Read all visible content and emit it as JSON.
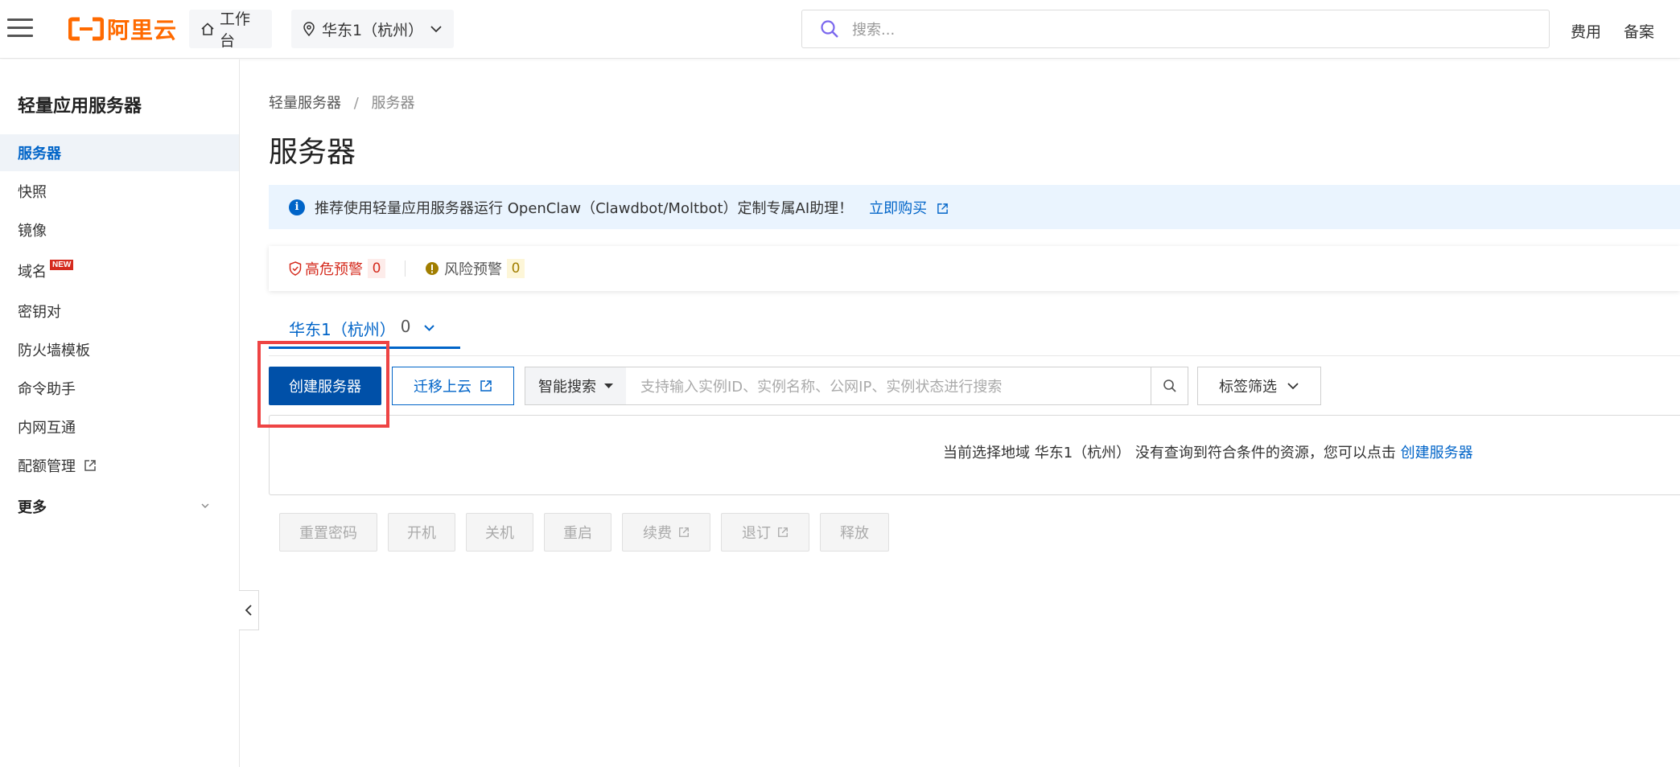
{
  "topbar": {
    "logo_text": "阿里云",
    "workbench_label": "工作台",
    "region_label": "华东1（杭州）",
    "search_placeholder": "搜索...",
    "links": [
      "费用",
      "备案"
    ]
  },
  "sidebar": {
    "title": "轻量应用服务器",
    "items": [
      {
        "label": "服务器",
        "active": true
      },
      {
        "label": "快照"
      },
      {
        "label": "镜像"
      },
      {
        "label": "域名",
        "badge": "NEW"
      },
      {
        "label": "密钥对"
      },
      {
        "label": "防火墙模板"
      },
      {
        "label": "命令助手"
      },
      {
        "label": "内网互通"
      },
      {
        "label": "配额管理",
        "external": true
      }
    ],
    "more_label": "更多"
  },
  "main": {
    "breadcrumb": [
      "轻量服务器",
      "服务器"
    ],
    "title": "服务器",
    "notice": {
      "text": "推荐使用轻量应用服务器运行 OpenClaw（Clawdbot/Moltbot）定制专属AI助理！",
      "link": "立即购买"
    },
    "alerts": {
      "high_label": "高危预警",
      "high_count": "0",
      "risk_label": "风险预警",
      "risk_count": "0"
    },
    "region_tab": {
      "label": "华东1（杭州）",
      "count": "0"
    },
    "toolbar": {
      "create_label": "创建服务器",
      "migrate_label": "迁移上云",
      "search_mode": "智能搜索",
      "search_placeholder": "支持输入实例ID、实例名称、公网IP、实例状态进行搜索",
      "tag_filter_label": "标签筛选"
    },
    "empty": {
      "text": "当前选择地域 华东1（杭州） 没有查询到符合条件的资源，您可以点击",
      "link": "创建服务器"
    },
    "actions": [
      "重置密码",
      "开机",
      "关机",
      "重启",
      "续费",
      "退订",
      "释放"
    ]
  },
  "colors": {
    "brand": "#ff6a00",
    "primary": "#0064c8",
    "primary_dark": "#0050a8",
    "danger": "#d52b1e",
    "warning": "#b8860b",
    "highlight": "#ee4444"
  },
  "icons": [
    "menu-icon",
    "home-icon",
    "location-pin-icon",
    "chevron-down-icon",
    "search-icon",
    "info-icon",
    "shield-icon",
    "warning-icon",
    "external-link-icon",
    "chevron-left-icon"
  ]
}
